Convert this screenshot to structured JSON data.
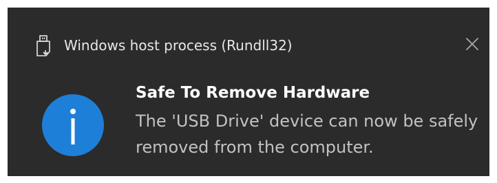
{
  "notification": {
    "app_name": "Windows host process (Rundll32)",
    "app_icon": "usb-drive-icon",
    "close_icon": "close-icon",
    "status_icon": "info-icon",
    "title": "Safe To Remove Hardware",
    "message": "The 'USB Drive' device can now be safely removed from the computer."
  },
  "colors": {
    "background": "#2b2b2b",
    "info_accent": "#1e7fd8",
    "title_text": "#ffffff",
    "body_text": "#c2c2c2"
  }
}
